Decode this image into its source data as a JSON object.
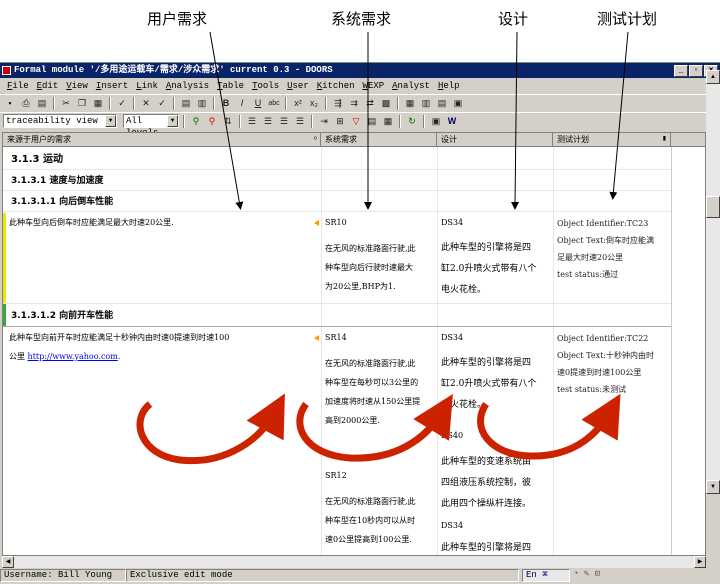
{
  "annotations": [
    "用户需求",
    "系统需求",
    "设计",
    "测试计划"
  ],
  "window": {
    "title": "Formal module '/多用途运载车/需求/涉众需求' current 0.3 - DOORS",
    "buttons": [
      "_",
      "▫",
      "×"
    ]
  },
  "menu": [
    "File",
    "Edit",
    "View",
    "Insert",
    "Link",
    "Analysis",
    "Table",
    "Tools",
    "User",
    "Kitchen",
    "WEXP",
    "Analyst",
    "Help"
  ],
  "toolbar": {
    "view": "traceability view",
    "level": "All levels"
  },
  "columns": [
    "来源于用户的需求",
    "系统需求",
    "设计",
    "测试计划"
  ],
  "headings": {
    "h313": "3.1.3 运动",
    "h3131": "3.1.3.1 速度与加速度",
    "h31311": "3.1.3.1.1 向后倒车性能",
    "h31312": "3.1.3.1.2 向前开车性能"
  },
  "rows": [
    {
      "requirement": "此种车型向后倒车时应能满足最大时速20公里.",
      "sys_id": "SR10",
      "sys_text": [
        "在无风的标准路面行驶,此",
        "种车型向后行驶时速最大",
        "为20公里,BHP为1."
      ],
      "design_id": "DS34",
      "design_text": [
        "此种车型的引擎将是四",
        "缸2.0升喷火式带有八个",
        "电火花栓。"
      ],
      "test": [
        "Object Identifier:TC23",
        "Object Text:倒车时应能满",
        "足最大时速20公里",
        "test status:通过"
      ]
    },
    {
      "requirement": "此种车型向前开车时应能满足十秒钟内由时速0提速到时速100",
      "requirement_line2": "公里",
      "link": "http://www.yahoo.com",
      "link_suffix": ".",
      "sys_id": "SR14",
      "sys_text": [
        "在无风的标准路面行驶,此",
        "种车型在每秒可以3公里的",
        "加速度将时速从150公里提",
        "高到2000公里."
      ],
      "sys_id2": "SR12",
      "sys_text2": [
        "在无风的标准路面行驶,此",
        "种车型在10秒内可以从时",
        "速0公里提高到100公里."
      ],
      "design_id": "DS34",
      "design_text": [
        "此种车型的引擎将是四",
        "缸2.0升喷火式带有八个",
        "电火花栓。"
      ],
      "design_id2": "DS40",
      "design_text2": [
        "此种车型的变速系统由",
        "四组液压系统控制，彼",
        "此用四个操纵杆连接。"
      ],
      "design_id3": "DS34",
      "design_text3": [
        "此种车型的引擎将是四"
      ],
      "test": [
        "Object Identifier:TC22",
        "Object Text:十秒钟内由时",
        "速0提速到时速100公里",
        "test status:未测试"
      ]
    }
  ],
  "status": {
    "user": "Username:  Bill Young",
    "mode": "Exclusive edit mode",
    "ime": "En"
  },
  "colors": {
    "title_bg": "#0a246a",
    "arrow_red": "#cc2200",
    "marker": "#ff9900",
    "leftbar_yellow": "#e8e800",
    "leftbar_green": "#33aa33"
  }
}
